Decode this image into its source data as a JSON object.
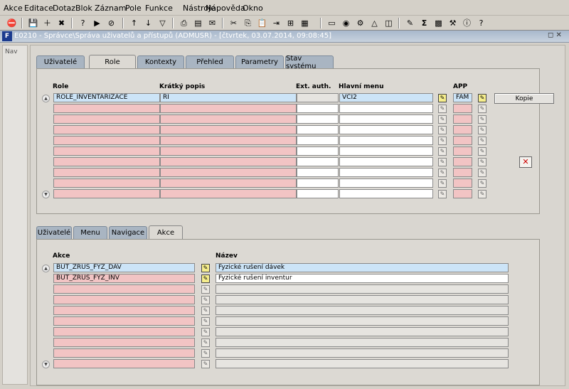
{
  "menu": [
    "Akce",
    "Editace",
    "Dotaz",
    "Blok",
    "Záznam",
    "Pole",
    "Funkce",
    "Nástroje",
    "Nápověda",
    "Okno"
  ],
  "toolbar_icons": [
    "exit-icon",
    "save-icon",
    "add-record-icon",
    "delete-record-icon",
    "enter-query-icon",
    "execute-query-icon",
    "cancel-query-icon",
    "sort-asc-icon",
    "sort-desc-icon",
    "filter-icon",
    "print-icon",
    "form-icon",
    "mail-icon",
    "cut-icon",
    "copy-icon",
    "paste-icon",
    "indent-icon",
    "insert-icon",
    "calculator-icon",
    "document-icon",
    "globe-icon",
    "gear-icon",
    "warning-icon",
    "graph-icon",
    "edit-icon",
    "sum-icon",
    "excel-icon",
    "tools-icon",
    "help-icon",
    "question-icon"
  ],
  "window": {
    "title": "E0210 - Správce\\Správa uživatelů a přístupů (ADMUSR) - [čtvrtek, 03.07.2014, 09:08:45]",
    "controls": "◻ ✕"
  },
  "nav": {
    "label": "Nav"
  },
  "top_tabs": [
    {
      "label": "Uživatelé"
    },
    {
      "label": "Role"
    },
    {
      "label": "Kontexty"
    },
    {
      "label": "Přehled"
    },
    {
      "label": "Parametry"
    },
    {
      "label": "Stav systému"
    }
  ],
  "roles_grid": {
    "headers": {
      "role": "Role",
      "short": "Krátký popis",
      "ext": "Ext. auth.",
      "menu": "Hlavní menu",
      "app": "APP"
    },
    "rows": [
      {
        "role": "ROLE_INVENTARIZACE",
        "short": "RI",
        "ext": "",
        "menu": "VCI2",
        "app": "FAM"
      },
      {
        "role": "",
        "short": "",
        "ext": "",
        "menu": "",
        "app": ""
      },
      {
        "role": "",
        "short": "",
        "ext": "",
        "menu": "",
        "app": ""
      },
      {
        "role": "",
        "short": "",
        "ext": "",
        "menu": "",
        "app": ""
      },
      {
        "role": "",
        "short": "",
        "ext": "",
        "menu": "",
        "app": ""
      },
      {
        "role": "",
        "short": "",
        "ext": "",
        "menu": "",
        "app": ""
      },
      {
        "role": "",
        "short": "",
        "ext": "",
        "menu": "",
        "app": ""
      },
      {
        "role": "",
        "short": "",
        "ext": "",
        "menu": "",
        "app": ""
      },
      {
        "role": "",
        "short": "",
        "ext": "",
        "menu": "",
        "app": ""
      },
      {
        "role": "",
        "short": "",
        "ext": "",
        "menu": "",
        "app": ""
      }
    ],
    "copy_button": "Kopie"
  },
  "bottom_tabs": [
    {
      "label": "Uživatelé"
    },
    {
      "label": "Menu"
    },
    {
      "label": "Navigace"
    },
    {
      "label": "Akce"
    }
  ],
  "actions_grid": {
    "headers": {
      "action": "Akce",
      "name": "Název"
    },
    "rows": [
      {
        "action": "BUT_ZRUS_FYZ_DAV",
        "name": "Fyzické rušení dávek"
      },
      {
        "action": "BUT_ZRUS_FYZ_INV",
        "name": "Fyzické rušení inventur"
      },
      {
        "action": "",
        "name": ""
      },
      {
        "action": "",
        "name": ""
      },
      {
        "action": "",
        "name": ""
      },
      {
        "action": "",
        "name": ""
      },
      {
        "action": "",
        "name": ""
      },
      {
        "action": "",
        "name": ""
      },
      {
        "action": "",
        "name": ""
      },
      {
        "action": "",
        "name": ""
      }
    ]
  }
}
